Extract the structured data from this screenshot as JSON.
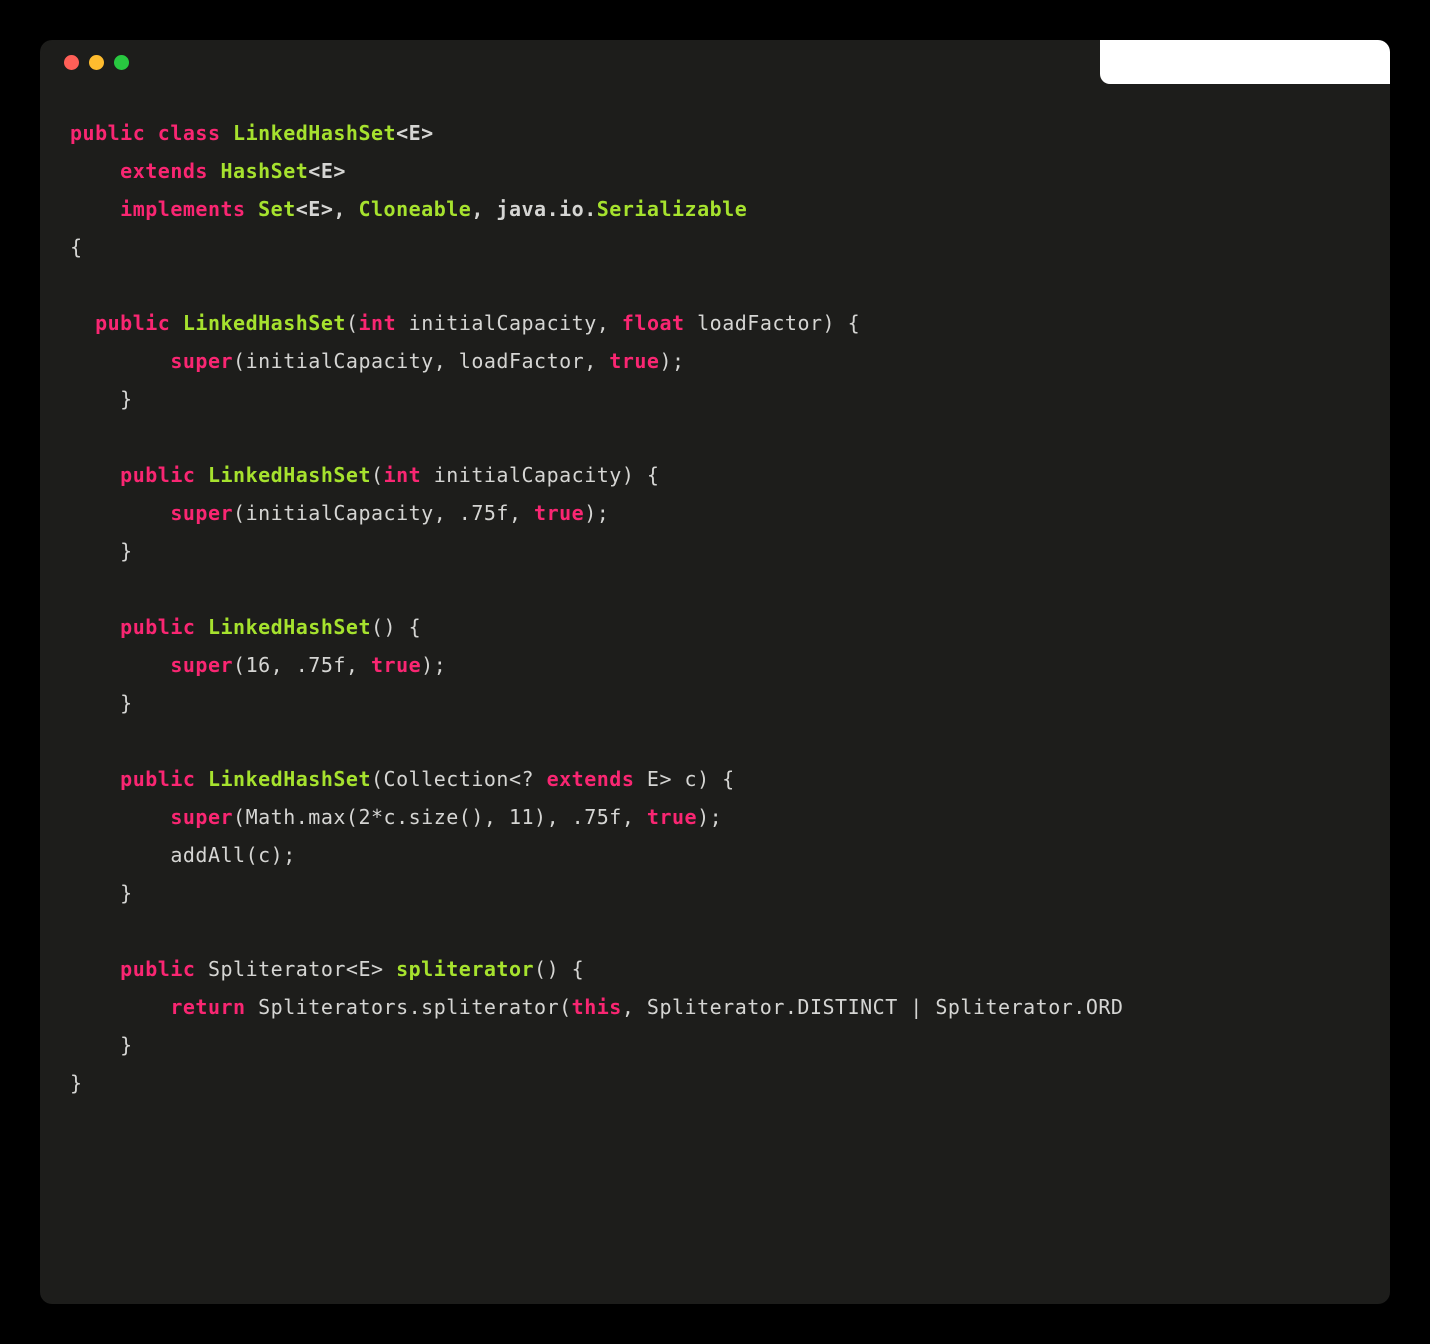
{
  "traffic_lights": {
    "red": "close",
    "yellow": "minimize",
    "green": "maximize"
  },
  "code": {
    "lines": [
      [
        {
          "t": "public ",
          "c": "kw"
        },
        {
          "t": "class ",
          "c": "kw"
        },
        {
          "t": "LinkedHashSet",
          "c": "type"
        },
        {
          "t": "<E>",
          "c": "plain bold"
        }
      ],
      [
        {
          "t": "    ",
          "c": "plain"
        },
        {
          "t": "extends ",
          "c": "kw"
        },
        {
          "t": "HashSet",
          "c": "type"
        },
        {
          "t": "<E>",
          "c": "plain bold"
        }
      ],
      [
        {
          "t": "    ",
          "c": "plain"
        },
        {
          "t": "implements ",
          "c": "kw"
        },
        {
          "t": "Set",
          "c": "type"
        },
        {
          "t": "<E>, ",
          "c": "plain bold"
        },
        {
          "t": "Cloneable",
          "c": "type"
        },
        {
          "t": ", java.io.",
          "c": "plain bold"
        },
        {
          "t": "Serializable",
          "c": "type"
        }
      ],
      [
        {
          "t": "{",
          "c": "plain"
        }
      ],
      [
        {
          "t": "",
          "c": "plain"
        }
      ],
      [
        {
          "t": "  ",
          "c": "plain"
        },
        {
          "t": "public ",
          "c": "kw"
        },
        {
          "t": "LinkedHashSet",
          "c": "method"
        },
        {
          "t": "(",
          "c": "plain"
        },
        {
          "t": "int",
          "c": "kw"
        },
        {
          "t": " initialCapacity, ",
          "c": "plain"
        },
        {
          "t": "float",
          "c": "kw"
        },
        {
          "t": " loadFactor) {",
          "c": "plain"
        }
      ],
      [
        {
          "t": "        ",
          "c": "plain"
        },
        {
          "t": "super",
          "c": "kw"
        },
        {
          "t": "(initialCapacity, loadFactor, ",
          "c": "plain"
        },
        {
          "t": "true",
          "c": "kw"
        },
        {
          "t": ");",
          "c": "plain"
        }
      ],
      [
        {
          "t": "    }",
          "c": "plain"
        }
      ],
      [
        {
          "t": "",
          "c": "plain"
        }
      ],
      [
        {
          "t": "    ",
          "c": "plain"
        },
        {
          "t": "public ",
          "c": "kw"
        },
        {
          "t": "LinkedHashSet",
          "c": "method"
        },
        {
          "t": "(",
          "c": "plain"
        },
        {
          "t": "int",
          "c": "kw"
        },
        {
          "t": " initialCapacity) {",
          "c": "plain"
        }
      ],
      [
        {
          "t": "        ",
          "c": "plain"
        },
        {
          "t": "super",
          "c": "kw"
        },
        {
          "t": "(initialCapacity, .75f, ",
          "c": "plain"
        },
        {
          "t": "true",
          "c": "kw"
        },
        {
          "t": ");",
          "c": "plain"
        }
      ],
      [
        {
          "t": "    }",
          "c": "plain"
        }
      ],
      [
        {
          "t": "",
          "c": "plain"
        }
      ],
      [
        {
          "t": "    ",
          "c": "plain"
        },
        {
          "t": "public ",
          "c": "kw"
        },
        {
          "t": "LinkedHashSet",
          "c": "method"
        },
        {
          "t": "() {",
          "c": "plain"
        }
      ],
      [
        {
          "t": "        ",
          "c": "plain"
        },
        {
          "t": "super",
          "c": "kw"
        },
        {
          "t": "(16, .75f, ",
          "c": "plain"
        },
        {
          "t": "true",
          "c": "kw"
        },
        {
          "t": ");",
          "c": "plain"
        }
      ],
      [
        {
          "t": "    }",
          "c": "plain"
        }
      ],
      [
        {
          "t": "",
          "c": "plain"
        }
      ],
      [
        {
          "t": "    ",
          "c": "plain"
        },
        {
          "t": "public ",
          "c": "kw"
        },
        {
          "t": "LinkedHashSet",
          "c": "method"
        },
        {
          "t": "(Collection<? ",
          "c": "plain"
        },
        {
          "t": "extends",
          "c": "kw"
        },
        {
          "t": " E> c) {",
          "c": "plain"
        }
      ],
      [
        {
          "t": "        ",
          "c": "plain"
        },
        {
          "t": "super",
          "c": "kw"
        },
        {
          "t": "(Math.max(2*c.size(), 11), .75f, ",
          "c": "plain"
        },
        {
          "t": "true",
          "c": "kw"
        },
        {
          "t": ");",
          "c": "plain"
        }
      ],
      [
        {
          "t": "        addAll(c);",
          "c": "plain"
        }
      ],
      [
        {
          "t": "    }",
          "c": "plain"
        }
      ],
      [
        {
          "t": "",
          "c": "plain"
        }
      ],
      [
        {
          "t": "    ",
          "c": "plain"
        },
        {
          "t": "public",
          "c": "kw"
        },
        {
          "t": " Spliterator<E> ",
          "c": "plain"
        },
        {
          "t": "spliterator",
          "c": "method"
        },
        {
          "t": "() {",
          "c": "plain"
        }
      ],
      [
        {
          "t": "        ",
          "c": "plain"
        },
        {
          "t": "return",
          "c": "kw"
        },
        {
          "t": " Spliterators.spliterator(",
          "c": "plain"
        },
        {
          "t": "this",
          "c": "kw"
        },
        {
          "t": ", Spliterator.DISTINCT | Spliterator.ORD",
          "c": "plain"
        }
      ],
      [
        {
          "t": "    }",
          "c": "plain"
        }
      ],
      [
        {
          "t": "}",
          "c": "plain"
        }
      ]
    ]
  }
}
